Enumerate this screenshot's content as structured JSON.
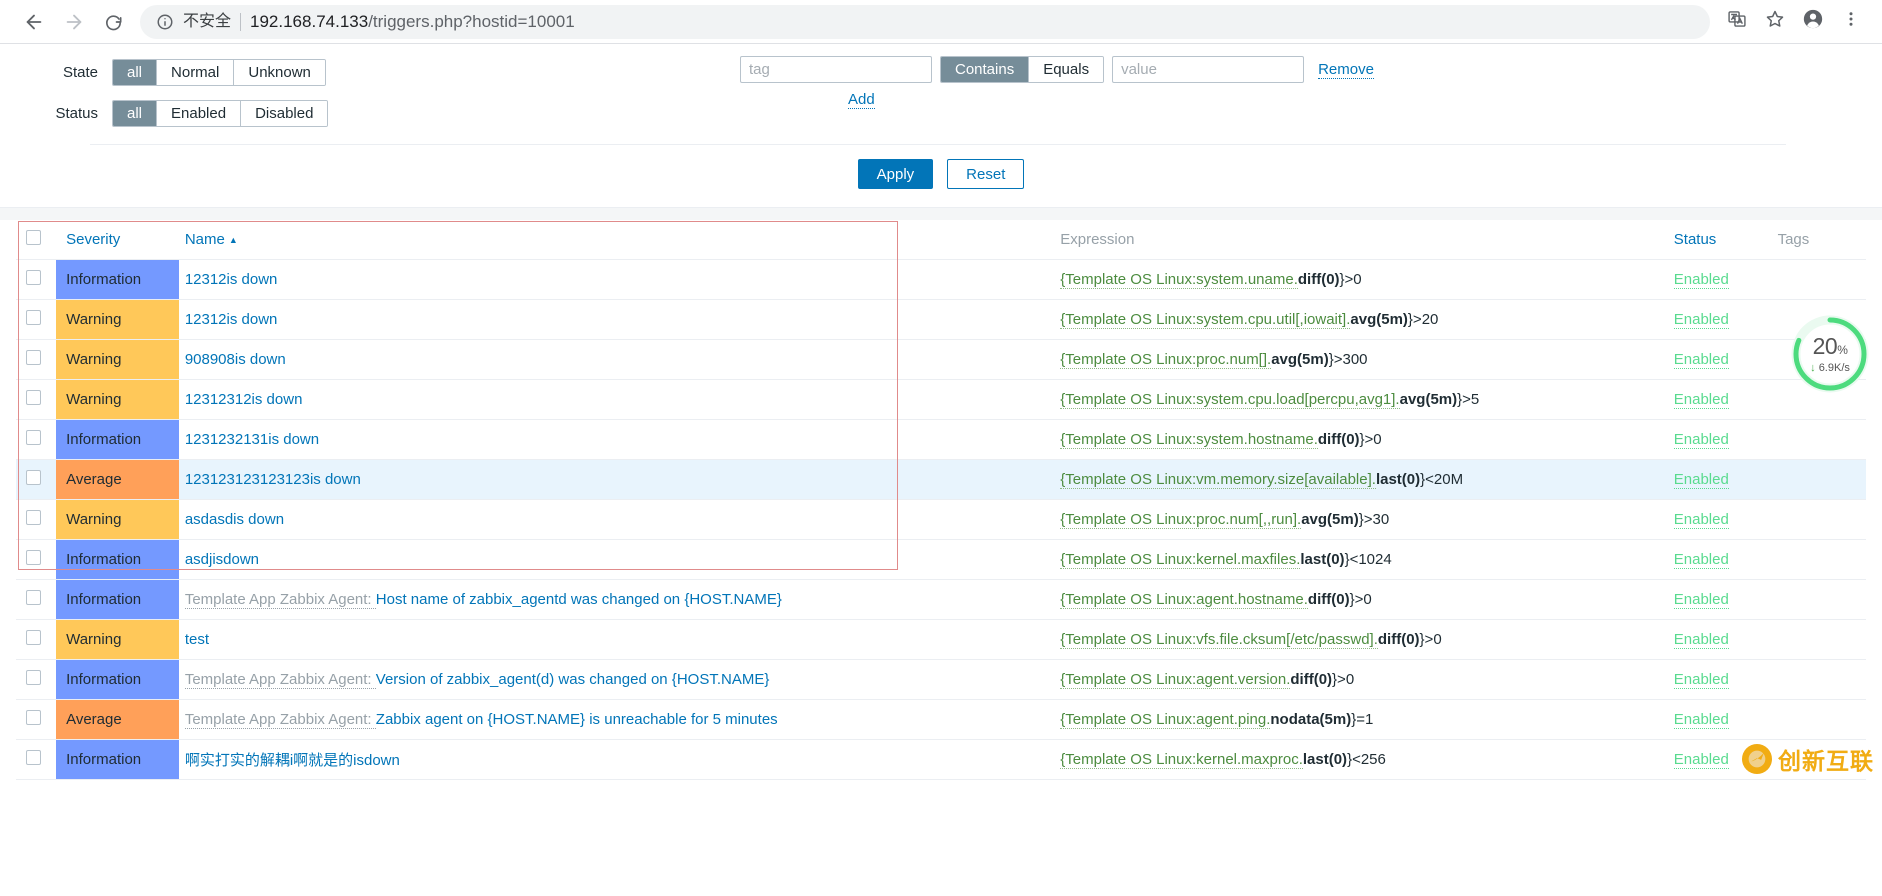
{
  "browser": {
    "back_icon": "back-arrow-icon",
    "forward_icon": "forward-arrow-icon",
    "reload_icon": "reload-icon",
    "info_icon": "info-circle-icon",
    "insecure_label": "不安全",
    "url_host": "192.168.74.133",
    "url_path": "/triggers.php?hostid=10001",
    "translate_icon": "translate-icon",
    "bookmark_icon": "star-icon",
    "profile_icon": "profile-avatar-icon",
    "menu_icon": "three-dots-menu-icon"
  },
  "filter": {
    "state": {
      "label": "State",
      "options": [
        "all",
        "Normal",
        "Unknown"
      ],
      "selected": "all"
    },
    "status": {
      "label": "Status",
      "options": [
        "all",
        "Enabled",
        "Disabled"
      ],
      "selected": "all"
    },
    "tag": {
      "name_placeholder": "tag",
      "name_value": "",
      "operators": [
        "Contains",
        "Equals"
      ],
      "selected_operator": "Contains",
      "value_placeholder": "value",
      "value_value": "",
      "remove_label": "Remove",
      "add_label": "Add"
    },
    "apply_label": "Apply",
    "reset_label": "Reset"
  },
  "table": {
    "headers": {
      "severity": "Severity",
      "name": "Name",
      "sort_arrow": "▲",
      "expression": "Expression",
      "status": "Status",
      "tags": "Tags"
    },
    "rows": [
      {
        "severity": "Information",
        "severity_class": "sev-information",
        "name_prefix": "",
        "name": "12312is down",
        "expr_link": "{Template OS Linux:system.uname.",
        "expr_fn": "diff(0)",
        "expr_tail": "}>0",
        "status": "Enabled",
        "tags": "",
        "highlight": false
      },
      {
        "severity": "Warning",
        "severity_class": "sev-warning",
        "name_prefix": "",
        "name": "12312is down",
        "expr_link": "{Template OS Linux:system.cpu.util[,iowait].",
        "expr_fn": "avg(5m)",
        "expr_tail": "}>20",
        "status": "Enabled",
        "tags": "",
        "highlight": false
      },
      {
        "severity": "Warning",
        "severity_class": "sev-warning",
        "name_prefix": "",
        "name": "908908is down",
        "expr_link": "{Template OS Linux:proc.num[].",
        "expr_fn": "avg(5m)",
        "expr_tail": "}>300",
        "status": "Enabled",
        "tags": "",
        "highlight": false
      },
      {
        "severity": "Warning",
        "severity_class": "sev-warning",
        "name_prefix": "",
        "name": "12312312is down",
        "expr_link": "{Template OS Linux:system.cpu.load[percpu,avg1].",
        "expr_fn": "avg(5m)",
        "expr_tail": "}>5",
        "status": "Enabled",
        "tags": "",
        "highlight": false
      },
      {
        "severity": "Information",
        "severity_class": "sev-information",
        "name_prefix": "",
        "name": "1231232131is down",
        "expr_link": "{Template OS Linux:system.hostname.",
        "expr_fn": "diff(0)",
        "expr_tail": "}>0",
        "status": "Enabled",
        "tags": "",
        "highlight": false
      },
      {
        "severity": "Average",
        "severity_class": "sev-average",
        "name_prefix": "",
        "name": "123123123123123is down",
        "expr_link": "{Template OS Linux:vm.memory.size[available].",
        "expr_fn": "last(0)",
        "expr_tail": "}<20M",
        "status": "Enabled",
        "tags": "",
        "highlight": true
      },
      {
        "severity": "Warning",
        "severity_class": "sev-warning",
        "name_prefix": "",
        "name": "asdasdis down",
        "expr_link": "{Template OS Linux:proc.num[,,run].",
        "expr_fn": "avg(5m)",
        "expr_tail": "}>30",
        "status": "Enabled",
        "tags": "",
        "highlight": false
      },
      {
        "severity": "Information",
        "severity_class": "sev-information",
        "name_prefix": "",
        "name": "asdjisdown",
        "expr_link": "{Template OS Linux:kernel.maxfiles.",
        "expr_fn": "last(0)",
        "expr_tail": "}<1024",
        "status": "Enabled",
        "tags": "",
        "highlight": false
      },
      {
        "severity": "Information",
        "severity_class": "sev-information",
        "name_prefix": "Template App Zabbix Agent: ",
        "name": "Host name of zabbix_agentd was changed on {HOST.NAME}",
        "expr_link": "{Template OS Linux:agent.hostname.",
        "expr_fn": "diff(0)",
        "expr_tail": "}>0",
        "status": "Enabled",
        "tags": "",
        "highlight": false
      },
      {
        "severity": "Warning",
        "severity_class": "sev-warning",
        "name_prefix": "",
        "name": "test",
        "expr_link": "{Template OS Linux:vfs.file.cksum[/etc/passwd].",
        "expr_fn": "diff(0)",
        "expr_tail": "}>0",
        "status": "Enabled",
        "tags": "",
        "highlight": false
      },
      {
        "severity": "Information",
        "severity_class": "sev-information",
        "name_prefix": "Template App Zabbix Agent: ",
        "name": "Version of zabbix_agent(d) was changed on {HOST.NAME}",
        "expr_link": "{Template OS Linux:agent.version.",
        "expr_fn": "diff(0)",
        "expr_tail": "}>0",
        "status": "Enabled",
        "tags": "",
        "highlight": false
      },
      {
        "severity": "Average",
        "severity_class": "sev-average",
        "name_prefix": "Template App Zabbix Agent: ",
        "name": "Zabbix agent on {HOST.NAME} is unreachable for 5 minutes",
        "expr_link": "{Template OS Linux:agent.ping.",
        "expr_fn": "nodata(5m)",
        "expr_tail": "}=1",
        "status": "Enabled",
        "tags": "",
        "highlight": false
      },
      {
        "severity": "Information",
        "severity_class": "sev-information",
        "name_prefix": "",
        "name": "啊实打实的解耦i啊就是的isdown",
        "expr_link": "{Template OS Linux:kernel.maxproc.",
        "expr_fn": "last(0)",
        "expr_tail": "}<256",
        "status": "Enabled",
        "tags": "",
        "highlight": false
      }
    ]
  },
  "speed_widget": {
    "percent": "20",
    "percent_unit": "%",
    "arrow": "↓",
    "rate": "6.9K/s",
    "ring_color": "#4ddb7e"
  },
  "watermark": {
    "text": "创新互联"
  }
}
